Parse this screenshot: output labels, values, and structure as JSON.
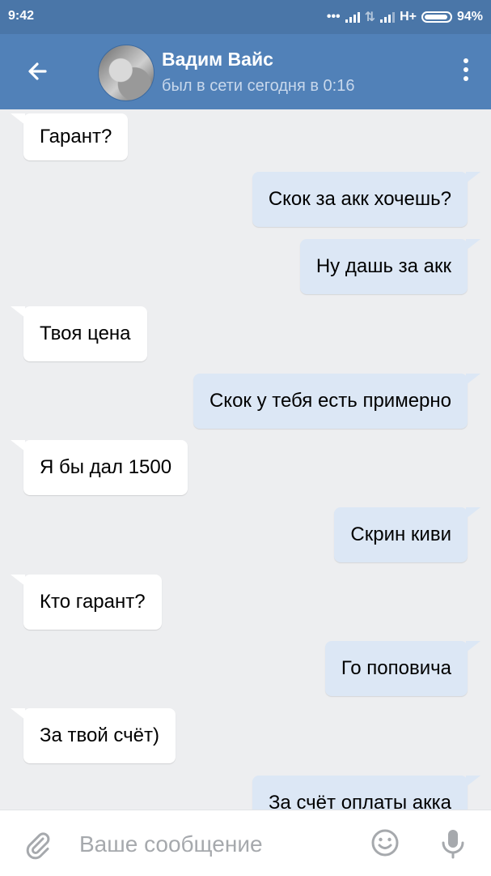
{
  "status_bar": {
    "time": "9:42",
    "network": "H+",
    "battery": "94%",
    "battery_level": 0.94
  },
  "header": {
    "contact_name": "Вадим Вайс",
    "contact_status": "был в сети сегодня в 0:16",
    "back_icon": "arrow-left-icon",
    "menu_icon": "more-vertical-icon",
    "bg_color": "#5181b8"
  },
  "messages": [
    {
      "direction": "in",
      "text": "Гарант?"
    },
    {
      "direction": "out",
      "text": "Скок за акк хочешь?"
    },
    {
      "direction": "out",
      "text": "Ну дашь за акк"
    },
    {
      "direction": "in",
      "text": "Твоя цена"
    },
    {
      "direction": "out",
      "text": "Скок у тебя есть примерно"
    },
    {
      "direction": "in",
      "text": "Я бы дал 1500"
    },
    {
      "direction": "out",
      "text": "Скрин киви"
    },
    {
      "direction": "in",
      "text": "Кто гарант?"
    },
    {
      "direction": "out",
      "text": "Го поповича"
    },
    {
      "direction": "in",
      "text": "За твой счёт)"
    },
    {
      "direction": "out",
      "text": "За счёт оплаты акка"
    }
  ],
  "input_bar": {
    "placeholder": "Ваше сообщение",
    "attach_icon": "paperclip-icon",
    "emoji_icon": "smiley-icon",
    "mic_icon": "microphone-icon"
  },
  "colors": {
    "incoming_bubble": "#ffffff",
    "outgoing_bubble": "#dce7f5",
    "chat_background": "#edeef0"
  }
}
